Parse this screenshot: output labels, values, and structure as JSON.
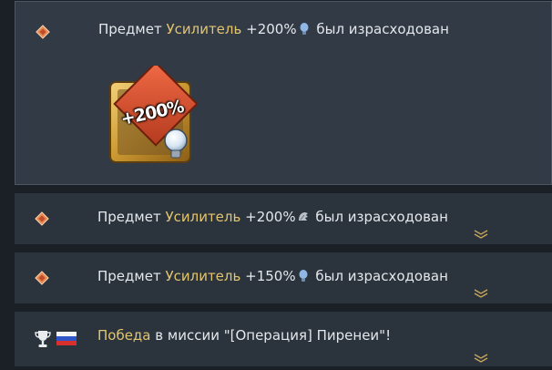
{
  "feed": {
    "items": [
      {
        "prefix": "Предмет",
        "item_name": "Усилитель",
        "bonus": "+200%",
        "bonus_icon": "lightbulb-icon",
        "suffix": "был израсходован",
        "expanded": true,
        "booster_label": "+200%"
      },
      {
        "prefix": "Предмет",
        "item_name": "Усилитель",
        "bonus": "+200%",
        "bonus_icon": "crew-skill-icon",
        "suffix": "был израсходован"
      },
      {
        "prefix": "Предмет",
        "item_name": "Усилитель",
        "bonus": "+150%",
        "bonus_icon": "lightbulb-icon",
        "suffix": "был израсходован"
      },
      {
        "highlight": "Победа",
        "text": "в миссии \"[Операция] Пиренеи\"!",
        "icons": [
          "trophy-icon",
          "russia-flag-icon"
        ]
      }
    ]
  },
  "colors": {
    "highlight": "#e3c56f",
    "row_bg": "#2b333d",
    "expanded_bg": "#313a45",
    "page_bg": "#1b2027"
  }
}
